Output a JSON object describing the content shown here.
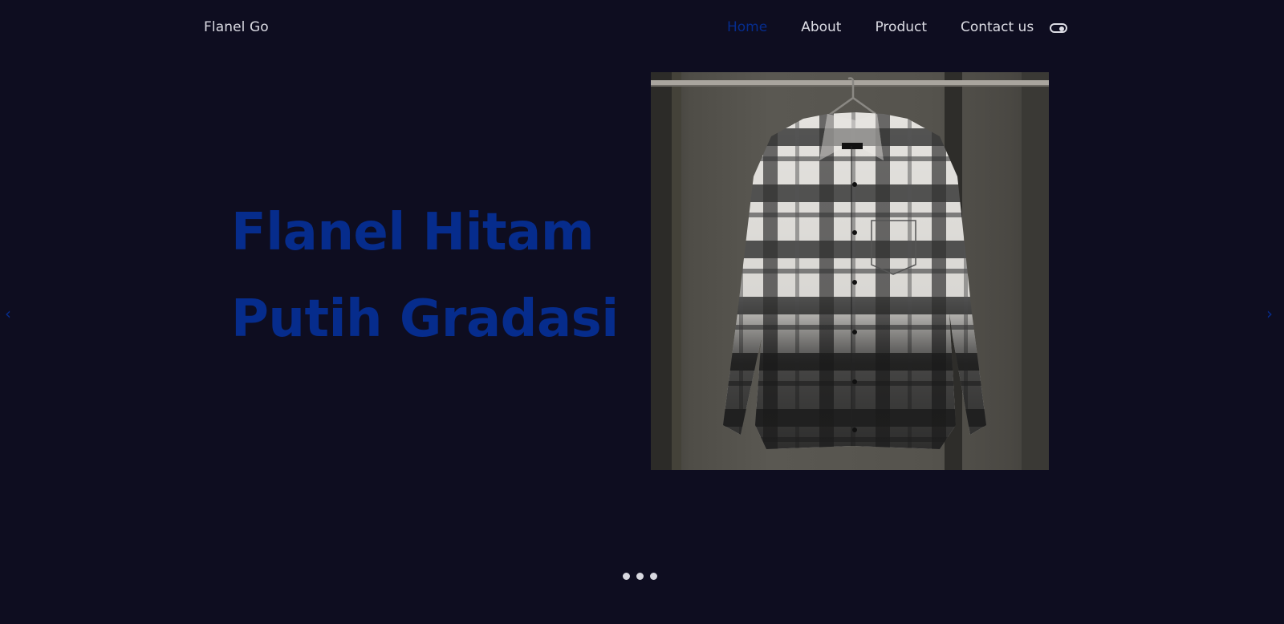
{
  "nav": {
    "brand": "Flanel Go",
    "links": [
      "Home",
      "About",
      "Product",
      "Contact us"
    ],
    "active": "Home",
    "theme_toggle_icon": "toggle-icon"
  },
  "hero": {
    "title_line1": "Flanel Hitam",
    "title_line2": "Putih Gradasi",
    "image_alt": "Black and white gradient flannel shirt on hanger"
  },
  "carousel": {
    "prev_icon": "chevron-left-icon",
    "next_icon": "chevron-right-icon",
    "prev_glyph": "‹",
    "next_glyph": "›",
    "slide_count": 3,
    "active_index": 0
  },
  "colors": {
    "background": "#0e0d20",
    "accent": "#062c8c",
    "text": "#dcdce4"
  }
}
